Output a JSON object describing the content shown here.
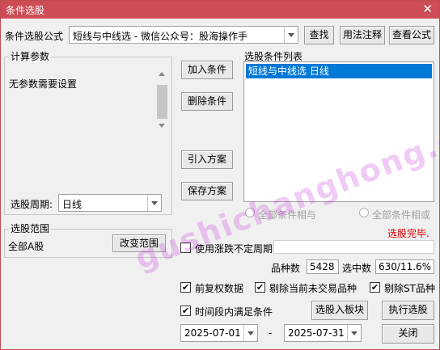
{
  "window": {
    "title": "条件选股"
  },
  "formula": {
    "label": "条件选股公式",
    "value": "短线与中线选  -  微信公众号：股海操作手",
    "find_btn": "查找",
    "usage_btn": "用法注释",
    "view_btn": "查看公式"
  },
  "params": {
    "group_title": "计算参数",
    "message": "无参数需要设置",
    "period_label": "选股周期:",
    "period_value": "日线"
  },
  "condition_buttons": {
    "add": "加入条件",
    "delete": "删除条件",
    "import": "引入方案",
    "save": "保存方案"
  },
  "condition_list": {
    "title": "选股条件列表",
    "items": [
      "短线与中线选  日线"
    ]
  },
  "logic": {
    "and_label": "全部条件相与",
    "or_label": "全部条件相或"
  },
  "status": "选股完毕.",
  "range": {
    "group_title": "选股范围",
    "value": "全部A股",
    "change_btn": "改变范围"
  },
  "options": {
    "variable_period": "使用涨跌不定周期",
    "count_label": "品种数",
    "count_value": "5428",
    "hit_label": "选中数",
    "hit_value": "630/11.6%",
    "pre_adjust": "前复权数据",
    "exclude_untraded": "剔除当前未交易品种",
    "exclude_st": "剔除ST品种",
    "period_satisfy": "时间段内满足条件"
  },
  "actions": {
    "to_block": "选股入板块",
    "execute": "执行选股",
    "close": "关闭"
  },
  "dates": {
    "start": "2025-07-01",
    "separator": "-",
    "end": "2025-07-31"
  },
  "watermark": "gushichanghong.com",
  "colors": {
    "title_bar": "#cc4d55",
    "selected_row": "#0078d7",
    "status_red": "#e00000"
  }
}
